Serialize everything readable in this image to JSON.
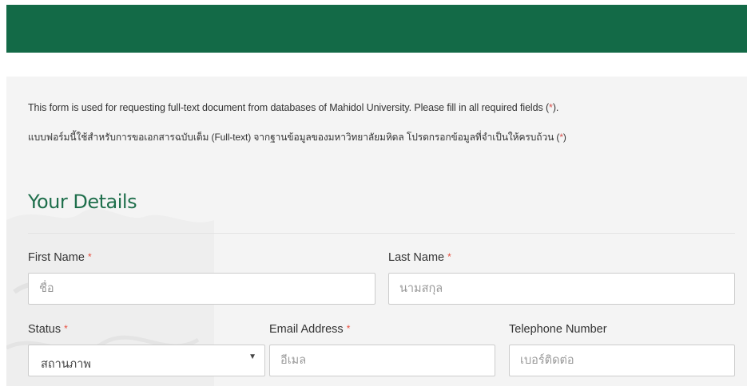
{
  "form": {
    "intro_en_main": "This form is used for requesting full-text document from databases of Mahidol University. Please fill in all required fields (",
    "intro_en_mark": "*",
    "intro_en_end": ").",
    "intro_th_main": "แบบฟอร์มนี้ใช้สำหรับการขอเอกสารฉบับเต็ม (Full-text) จากฐานข้อมูลของมหาวิทยาลัยมหิดล โปรดกรอกข้อมูลที่จำเป็นให้ครบถ้วน (",
    "intro_th_mark": "*",
    "intro_th_end": ")",
    "section_title": "Your Details",
    "required_mark": "*",
    "fields": {
      "first_name": {
        "label": "First Name",
        "placeholder": "ชื่อ"
      },
      "last_name": {
        "label": "Last Name",
        "placeholder": "นามสกุล"
      },
      "status": {
        "label": "Status",
        "selected": "สถานภาพ",
        "caret": "▼"
      },
      "email": {
        "label": "Email Address",
        "placeholder": "อีเมล"
      },
      "telephone": {
        "label": "Telephone Number",
        "placeholder": "เบอร์ติดต่อ"
      }
    }
  },
  "colors": {
    "banner": "#136a47",
    "title": "#1f6f4c",
    "required": "#e74c3c"
  }
}
